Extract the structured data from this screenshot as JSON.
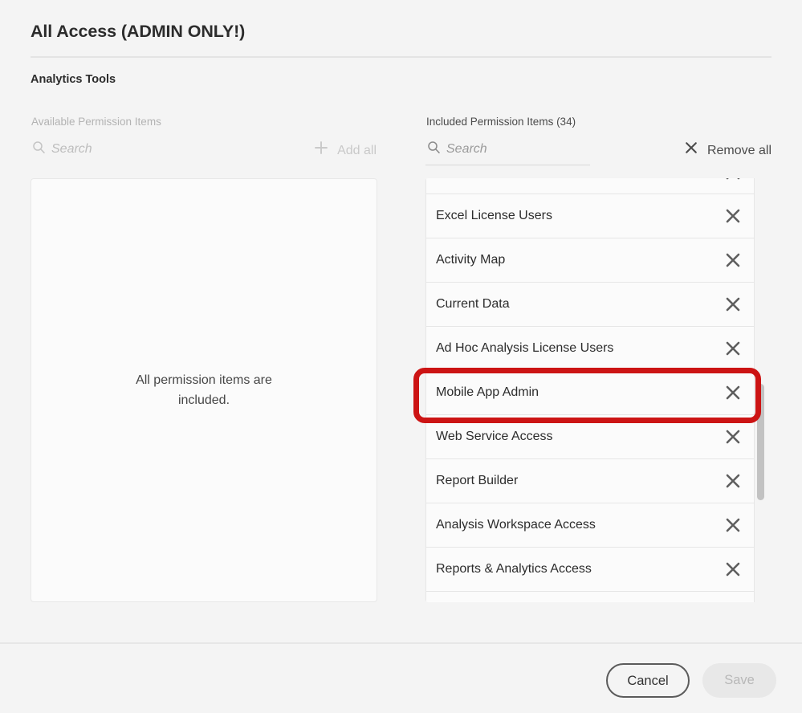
{
  "dialog": {
    "title": "All Access (ADMIN ONLY!)",
    "section_title": "Analytics Tools"
  },
  "available_panel": {
    "label": "Available Permission Items",
    "search_placeholder": "Search",
    "search_value": "",
    "search_icon": "search-icon",
    "bulk_action_label": "Add all",
    "bulk_action_icon": "plus-icon",
    "empty_message": "All permission items are included.",
    "disabled": true
  },
  "included_panel": {
    "label": "Included Permission Items (34)",
    "count": 34,
    "search_placeholder": "Search",
    "search_value": "",
    "search_icon": "search-icon",
    "bulk_action_label": "Remove all",
    "bulk_action_icon": "close-icon",
    "items": [
      {
        "label": "",
        "partial": true,
        "remove_icon": "close-icon"
      },
      {
        "label": "Excel License Users",
        "remove_icon": "close-icon"
      },
      {
        "label": "Activity Map",
        "remove_icon": "close-icon"
      },
      {
        "label": "Current Data",
        "remove_icon": "close-icon"
      },
      {
        "label": "Ad Hoc Analysis License Users",
        "remove_icon": "close-icon"
      },
      {
        "label": "Mobile App Admin",
        "remove_icon": "close-icon",
        "highlighted": true
      },
      {
        "label": "Web Service Access",
        "remove_icon": "close-icon"
      },
      {
        "label": "Report Builder",
        "remove_icon": "close-icon"
      },
      {
        "label": "Analysis Workspace Access",
        "remove_icon": "close-icon"
      },
      {
        "label": "Reports & Analytics Access",
        "remove_icon": "close-icon"
      },
      {
        "label": "",
        "partial": true,
        "remove_icon": "close-icon"
      }
    ]
  },
  "annotation": {
    "target": "Mobile App Admin",
    "color": "#cc1414"
  },
  "footer": {
    "cancel_label": "Cancel",
    "save_label": "Save",
    "save_disabled": true
  },
  "colors": {
    "background": "#f4f4f4",
    "text": "#2c2c2c",
    "muted": "#b3b3b3",
    "annotation": "#cc1414",
    "scrollbar": "#c2c2c2"
  }
}
